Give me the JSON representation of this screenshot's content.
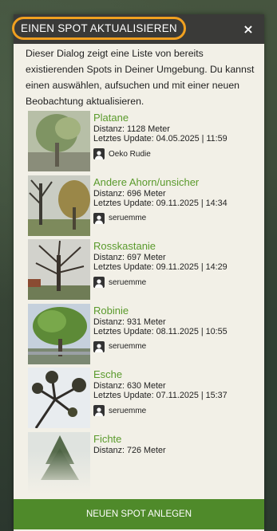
{
  "dialog": {
    "title": "EINEN SPOT AKTUALISIEREN",
    "close_label": "×",
    "intro": "Dieser Dialog zeigt eine Liste von bereits existierenden Spots in Deiner Umgebung. Du kannst einen auswählen, aufsuchen und mit einer neuen Beobachtung aktualisieren.",
    "footer_button": "NEUEN SPOT ANLEGEN"
  },
  "spots": [
    {
      "name": "Platane",
      "distance": "Distanz: 1128 Meter",
      "update": "Letztes Update: 04.05.2025 | 11:59",
      "user": "Oeko Rudie"
    },
    {
      "name": "Andere Ahorn/unsicher",
      "distance": "Distanz: 696 Meter",
      "update": "Letztes Update: 09.11.2025 | 14:34",
      "user": "seruemme"
    },
    {
      "name": "Rosskastanie",
      "distance": "Distanz: 697 Meter",
      "update": "Letztes Update: 09.11.2025 | 14:29",
      "user": "seruemme"
    },
    {
      "name": "Robinie",
      "distance": "Distanz: 931 Meter",
      "update": "Letztes Update: 08.11.2025 | 10:55",
      "user": "seruemme"
    },
    {
      "name": "Esche",
      "distance": "Distanz: 630 Meter",
      "update": "Letztes Update: 07.11.2025 | 15:37",
      "user": "seruemme"
    },
    {
      "name": "Fichte",
      "distance": "Distanz: 726 Meter",
      "update": "",
      "user": ""
    }
  ],
  "colors": {
    "accent_green": "#5a9a2c",
    "button_green": "#4f8a2a",
    "header_dark": "#3a3a38",
    "highlight_orange": "#f0a020"
  },
  "icons": {
    "close": "close-icon",
    "user": "user-icon"
  }
}
